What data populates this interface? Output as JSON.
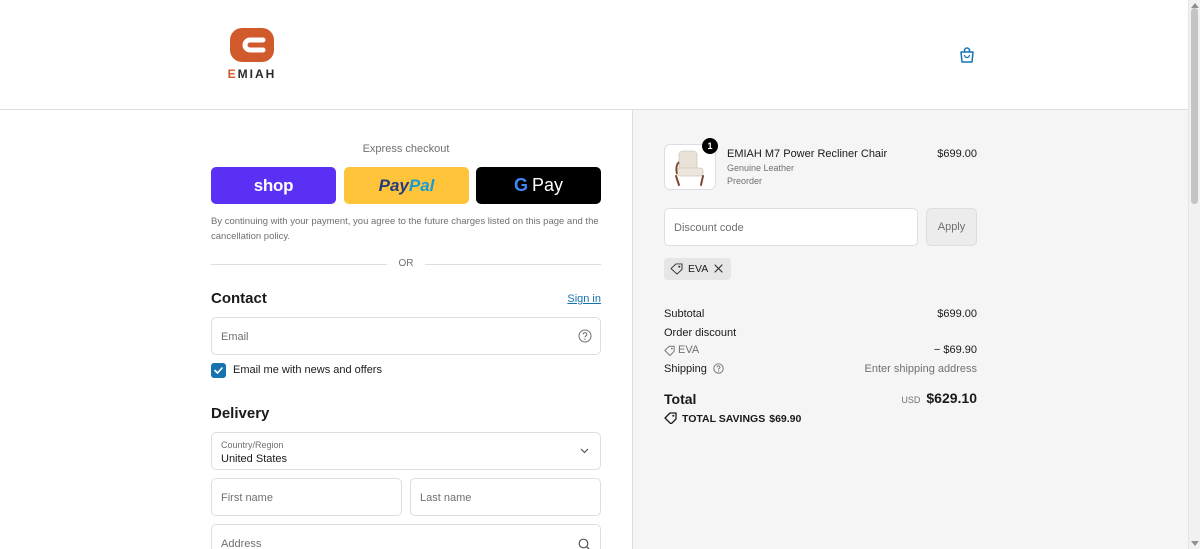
{
  "brand": {
    "logo_text_first": "E",
    "logo_text_rest": "MIAH",
    "accent_color": "#d05a2c"
  },
  "header": {
    "cart_icon": "shopping-bag-icon"
  },
  "express": {
    "title": "Express checkout",
    "shop_label": "shop",
    "paypal_label_1": "Pay",
    "paypal_label_2": "Pal",
    "gpay_g": "G",
    "gpay_label": "Pay",
    "consent": "By continuing with your payment, you agree to the future charges listed on this page and the cancellation policy.",
    "or_label": "OR"
  },
  "contact": {
    "title": "Contact",
    "sign_in": "Sign in",
    "email_placeholder": "Email",
    "newsletter_label": "Email me with news and offers",
    "newsletter_checked": true
  },
  "delivery": {
    "title": "Delivery",
    "country_label": "Country/Region",
    "country_value": "United States",
    "first_name_placeholder": "First name",
    "last_name_placeholder": "Last name",
    "address_placeholder": "Address"
  },
  "summary": {
    "item": {
      "quantity": "1",
      "name": "EMIAH M7 Power Recliner Chair",
      "variant": "Genuine Leather",
      "note": "Preorder",
      "price": "$699.00"
    },
    "discount_placeholder": "Discount code",
    "apply_label": "Apply",
    "applied_code": "EVA",
    "subtotal_label": "Subtotal",
    "subtotal_value": "$699.00",
    "order_discount_label": "Order discount",
    "discount_code": "EVA",
    "discount_value": "− $69.90",
    "shipping_label": "Shipping",
    "shipping_value": "Enter shipping address",
    "total_label": "Total",
    "total_currency": "USD",
    "total_value": "$629.10",
    "savings_label": "TOTAL SAVINGS",
    "savings_value": "$69.90"
  },
  "colors": {
    "shop_purple": "#5a31f4",
    "paypal_yellow": "#ffc439",
    "link_blue": "#1773b0"
  }
}
